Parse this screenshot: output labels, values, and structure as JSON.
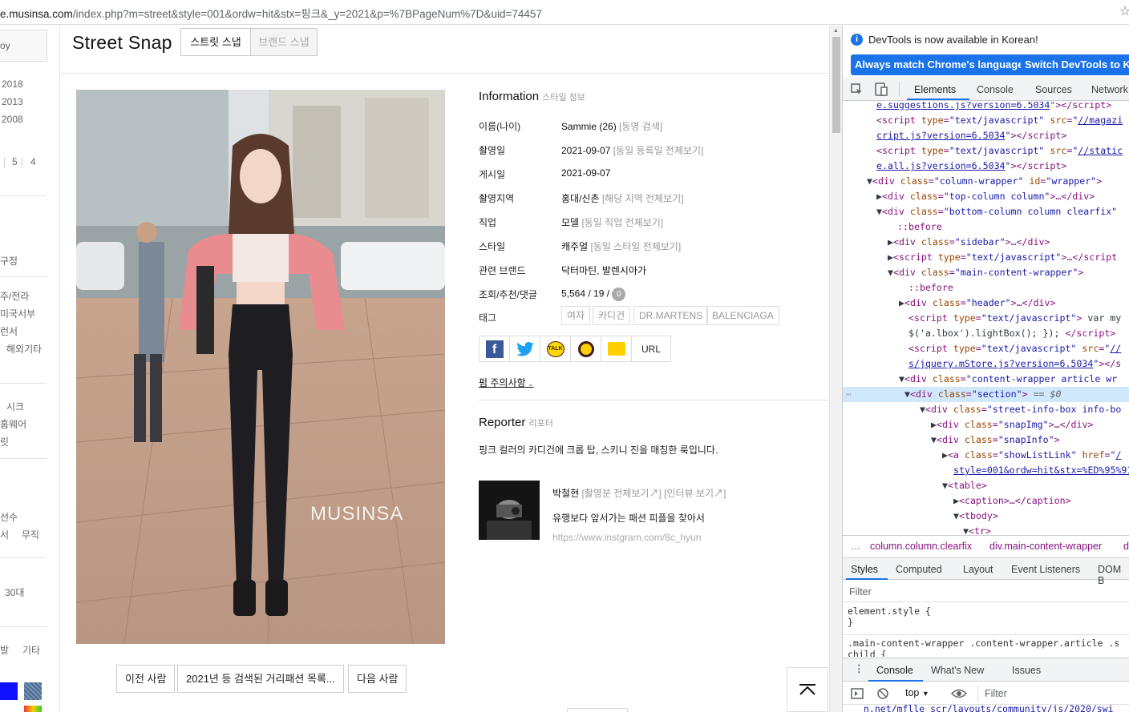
{
  "browser": {
    "url_prefix": "e.musinsa.com",
    "url_path": "/index.php?m=street&style=001&ordw=hit&stx=핑크&_y=2021&p=%7BPageNum%7D&uid=74457"
  },
  "sidebar": {
    "top_label": "oy",
    "years": [
      "2018",
      "2013",
      "2008"
    ],
    "pages": [
      "5",
      "4"
    ],
    "items_a": [
      "구정"
    ],
    "items_b": [
      "주/전라",
      "미국서부",
      "런서",
      "해외기타"
    ],
    "items_c": [
      "시크",
      "홈웨어",
      "릿"
    ],
    "items_d": [
      "선수",
      "서",
      "무직"
    ],
    "items_e": [
      "30대"
    ],
    "items_f": [
      "발",
      "기타"
    ]
  },
  "header": {
    "title": "Street Snap",
    "tab_street": "스트릿 스냅",
    "tab_brand": "브랜드 스냅"
  },
  "photo": {
    "watermark": "MUSINSA"
  },
  "information": {
    "heading": "Information",
    "heading_sub": "스타일 정보",
    "rows": [
      {
        "label": "이름(나이)",
        "value": "Sammie (26)",
        "link": "[동명 검색]"
      },
      {
        "label": "촬영일",
        "value": "2021-09-07",
        "link": "[동일 등록일 전체보기]"
      },
      {
        "label": "게시일",
        "value": "2021-09-07",
        "link": ""
      },
      {
        "label": "촬영지역",
        "value": "홍대/신촌",
        "link": "[해당 지역 전체보기]"
      },
      {
        "label": "직업",
        "value": "모델",
        "link": "[동일 직업 전체보기]"
      },
      {
        "label": "스타일",
        "value": "캐주얼",
        "link": "[동일 스타일 전체보기]"
      },
      {
        "label": "관련 브랜드",
        "value": "닥터마틴, 발렌시아가",
        "link": ""
      },
      {
        "label": "조회/추천/댓글",
        "value": "5,564 / 19 /",
        "link": ""
      }
    ],
    "comment_count": "0",
    "tags_label": "태그",
    "tags": [
      "여자",
      "카디건",
      "DR.MARTENS",
      "BALENCIAGA"
    ],
    "share_url_label": "URL",
    "notice": "펌 주의사항"
  },
  "reporter": {
    "heading": "Reporter",
    "heading_sub": "리포터",
    "comment": "핑크 컬러의 카디건에 크롭 탑, 스키니 진을 매칭한 룩입니다.",
    "name": "박철현",
    "link1": "[촬영분 전체보기↗]",
    "link2": "[인터뷰 보기↗]",
    "bio": "유행보다 앞서가는 패션 피플을 찾아서",
    "instagram": "https://www.instgram.com/8c_hyun"
  },
  "nav": {
    "prev": "이전 사람",
    "list": "2021년 등 검색된 거리패션 목록...",
    "next": "다음 사람"
  },
  "devtools": {
    "notice": "DevTools is now available in Korean!",
    "btn_match": "Always match Chrome's language",
    "btn_switch": "Switch DevTools to Ko",
    "tabs": [
      "Elements",
      "Console",
      "Sources",
      "Network"
    ],
    "breadcrumb_1": "column.column.clearfix",
    "breadcrumb_2": "div.main-content-wrapper",
    "breadcrumb_3": "d",
    "subtabs": [
      "Styles",
      "Computed",
      "Layout",
      "Event Listeners",
      "DOM B"
    ],
    "filter_placeholder": "Filter",
    "style_rule_1": "element.style {",
    "style_rule_1_end": "}",
    "style_rule_2": ".main-content-wrapper .content-wrapper.article .s",
    "style_rule_2b": "child {",
    "console_tabs": [
      "Console",
      "What's New",
      "Issues"
    ],
    "console_context": "top",
    "console_filter": "Filter",
    "console_tail": "n.net/mflle_scr/layouts/community/js/2020/swi"
  },
  "colors": {
    "accent": "#1a73e8",
    "selected_line": "#cfe8fc",
    "tag_color": "#881280"
  }
}
